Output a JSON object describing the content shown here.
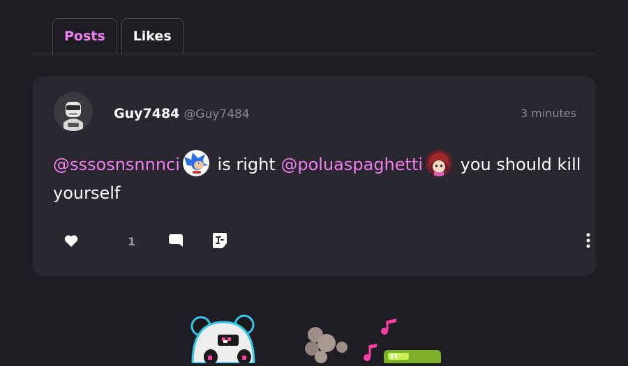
{
  "tabs": [
    {
      "label": "Posts",
      "active": true
    },
    {
      "label": "Likes",
      "active": false
    }
  ],
  "post": {
    "display_name": "Guy7484",
    "handle": "@Guy7484",
    "timestamp": "3 minutes",
    "body": {
      "mention1": "@sssosnsnnnci",
      "text1": " is right ",
      "mention2": "@poluaspaghetti",
      "text2": " you should kill yourself"
    },
    "like_count": "1"
  },
  "colors": {
    "background": "#1f1d24",
    "card": "#2a2730",
    "accent": "#f07ff0",
    "muted": "#8a8794"
  },
  "icons": [
    "heart-icon",
    "comment-icon",
    "repost-icon",
    "more-vertical-icon"
  ]
}
